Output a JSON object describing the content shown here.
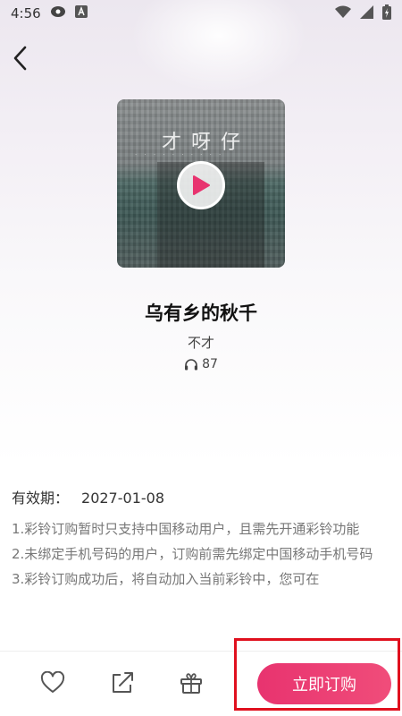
{
  "status_bar": {
    "time": "4:56",
    "left_icons": [
      "podcast-icon",
      "font-a-icon"
    ],
    "right_icons": [
      "wifi-icon",
      "signal-icon",
      "battery-charging-icon"
    ]
  },
  "nav": {
    "back_icon": "chevron-left-icon"
  },
  "cover": {
    "art_text": "才 呀 仔",
    "play_icon": "play-icon"
  },
  "song": {
    "title": "乌有乡的秋千",
    "artist": "不才",
    "play_count": "87",
    "play_count_icon": "headphones-icon"
  },
  "info": {
    "validity_label": "有效期：",
    "validity_date": "2027-01-08",
    "notes": [
      "1.彩铃订购暂时只支持中国移动用户，且需先开通彩铃功能",
      "2.未绑定手机号码的用户，订购前需先绑定中国移动手机号码",
      "3.彩铃订购成功后，将自动加入当前彩铃中，您可在"
    ]
  },
  "bottom_bar": {
    "icons": [
      "heart-icon",
      "share-icon",
      "gift-icon"
    ],
    "subscribe_label": "立即订购"
  },
  "colors": {
    "accent": "#e8336f",
    "highlight": "#e0101e"
  }
}
